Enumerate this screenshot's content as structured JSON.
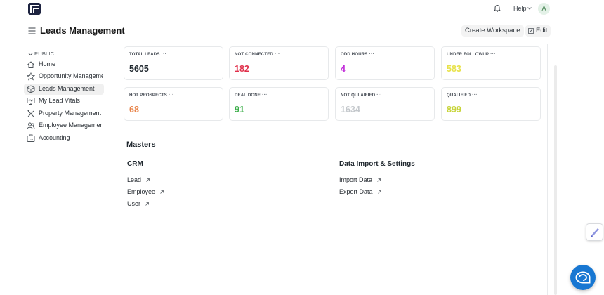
{
  "navbar": {
    "help_label": "Help",
    "avatar_initial": "A"
  },
  "header": {
    "title": "Leads Management",
    "create_workspace_label": "Create Workspace",
    "edit_label": "Edit"
  },
  "sidebar": {
    "section_label": "PUBLIC",
    "items": [
      {
        "label": "Home",
        "icon": "home-icon"
      },
      {
        "label": "Opportunity Management",
        "icon": "star-icon"
      },
      {
        "label": "Leads Management",
        "icon": "box-icon",
        "active": true
      },
      {
        "label": "My Lead Vitals",
        "icon": "monitor-icon"
      },
      {
        "label": "Property Management",
        "icon": "tools-icon"
      },
      {
        "label": "Employee Management",
        "icon": "users-icon"
      },
      {
        "label": "Accounting",
        "icon": "calculator-icon"
      }
    ]
  },
  "cards": [
    {
      "label": "TOTAL LEADS",
      "value": "5605",
      "color": "#1f272e"
    },
    {
      "label": "NOT CONNECTED",
      "value": "182",
      "color": "#e0304b"
    },
    {
      "label": "ODD HOURS",
      "value": "4",
      "color": "#c028d8"
    },
    {
      "label": "UNDER FOLLOWUP",
      "value": "583",
      "color": "#e8e24a"
    },
    {
      "label": "HOT PROSPECTS",
      "value": "68",
      "color": "#e8844a"
    },
    {
      "label": "DEAL DONE",
      "value": "91",
      "color": "#3cae4a"
    },
    {
      "label": "NOT QULAIFIED",
      "value": "1634",
      "color": "#c4c8cc"
    },
    {
      "label": "QUALIFIED",
      "value": "899",
      "color": "#c7d43a"
    }
  ],
  "masters": {
    "title": "Masters",
    "crm": {
      "title": "CRM",
      "links": [
        "Lead",
        "Employee",
        "User"
      ]
    },
    "data_import": {
      "title": "Data Import & Settings",
      "links": [
        "Import Data",
        "Export Data"
      ]
    }
  }
}
